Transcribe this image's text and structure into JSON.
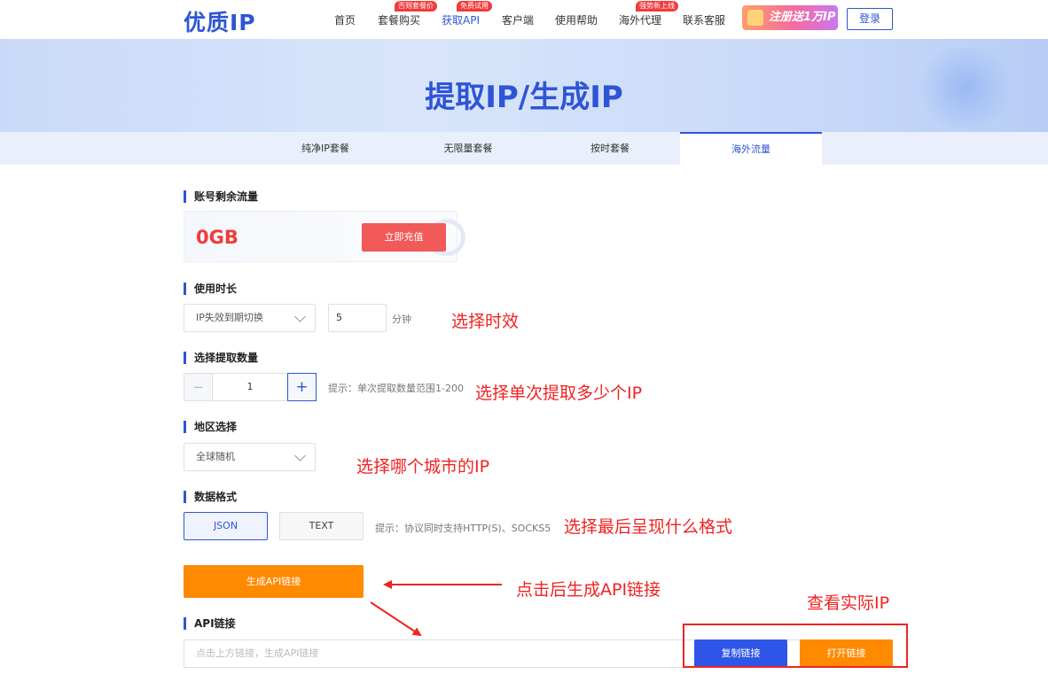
{
  "nav": {
    "logo": "优质IP",
    "items": [
      {
        "label": "首页",
        "badge": ""
      },
      {
        "label": "套餐购买",
        "badge": "否则套餐价"
      },
      {
        "label": "获取API",
        "badge": "免费试用"
      },
      {
        "label": "客户端",
        "badge": ""
      },
      {
        "label": "使用帮助",
        "badge": ""
      },
      {
        "label": "海外代理",
        "badge": "强势新上线"
      },
      {
        "label": "联系客服",
        "badge": ""
      }
    ],
    "promo": "注册送1万IP",
    "login": "登录"
  },
  "hero": {
    "title": "提取IP/生成IP"
  },
  "tabs": [
    {
      "label": "纯净IP套餐",
      "active": false
    },
    {
      "label": "无限量套餐",
      "active": false
    },
    {
      "label": "按时套餐",
      "active": false
    },
    {
      "label": "海外流量",
      "active": true
    }
  ],
  "balance": {
    "title": "账号剩余流量",
    "value": "0GB",
    "recharge": "立即充值"
  },
  "duration": {
    "title": "使用时长",
    "select": "IP失效到期切换",
    "minutes": "5",
    "unit": "分钟"
  },
  "quantity": {
    "title": "选择提取数量",
    "minus": "−",
    "value": "1",
    "plus": "+",
    "hint": "提示：单次提取数量范围1-200"
  },
  "region": {
    "title": "地区选择",
    "select": "全球随机"
  },
  "format": {
    "title": "数据格式",
    "json": "JSON",
    "text": "TEXT",
    "hint": "提示：协议同时支持HTTP(S)、SOCKS5"
  },
  "generate": "生成API链接",
  "api": {
    "title": "API链接",
    "placeholder": "点击上方链接，生成API链接",
    "copy": "复制链接",
    "open": "打开链接"
  },
  "annotations": {
    "duration": "选择时效",
    "quantity": "选择单次提取多少个IP",
    "region": "选择哪个城市的IP",
    "format": "选择最后呈现什么格式",
    "generate": "点击后生成API链接",
    "view": "查看实际IP"
  },
  "colors": {
    "brand": "#2f55d4",
    "orange": "#ff8a00",
    "red": "#f23b3b",
    "annotation": "#f02323"
  }
}
